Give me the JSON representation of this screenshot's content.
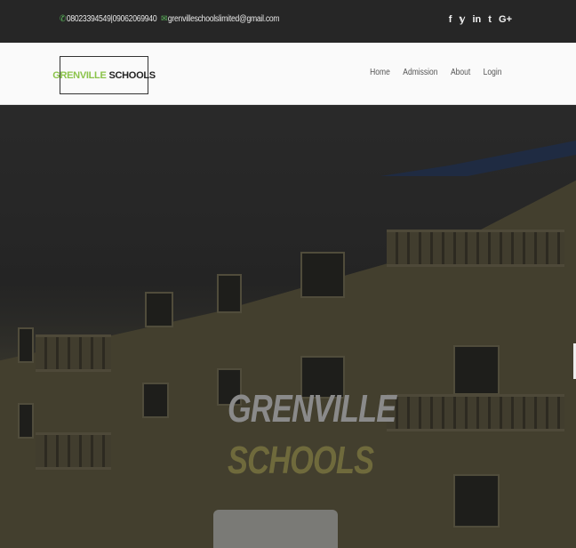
{
  "topbar": {
    "phone_icon": "phone-icon",
    "phone": "08023394549|09062069940",
    "email_icon": "email-icon",
    "email": "grenvilleschoolslimited@gmail.com",
    "socials": [
      {
        "icon": "facebook-icon",
        "glyph": "f"
      },
      {
        "icon": "twitter-icon",
        "glyph": "𝕪"
      },
      {
        "icon": "linkedin-icon",
        "glyph": "in"
      },
      {
        "icon": "tumblr-icon",
        "glyph": "t"
      },
      {
        "icon": "google-plus-icon",
        "glyph": "G+"
      }
    ]
  },
  "brand": {
    "logo_part1": "GRENVILLE",
    "logo_part2": "SCHOOLS",
    "accent_color": "#8bc34a"
  },
  "nav": {
    "items": [
      "Home",
      "Admission",
      "About",
      "Login"
    ]
  },
  "hero": {
    "title": "GRENVILLE",
    "subtitle": "SCHOOLS"
  }
}
